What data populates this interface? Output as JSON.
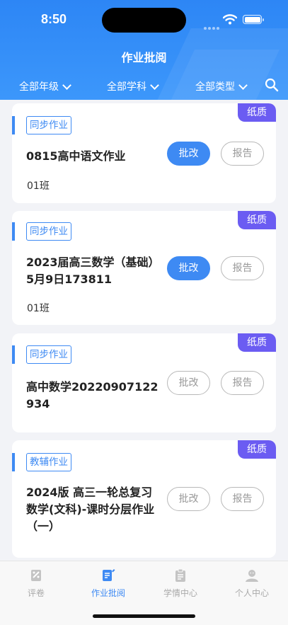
{
  "status_bar": {
    "time": "8:50"
  },
  "header": {
    "title": "作业批阅",
    "filters": [
      {
        "label": "全部年级"
      },
      {
        "label": "全部学科"
      },
      {
        "label": "全部类型"
      }
    ],
    "search_icon": "search-icon"
  },
  "cards": [
    {
      "tag": "同步作业",
      "badge": "纸质",
      "title": "0815高中语文作业",
      "class": "01班",
      "review_label": "批改",
      "report_label": "报告",
      "review_active": true
    },
    {
      "tag": "同步作业",
      "badge": "纸质",
      "title": "2023届高三数学（基础）5月9日173811",
      "class": "01班",
      "review_label": "批改",
      "report_label": "报告",
      "review_active": true
    },
    {
      "tag": "同步作业",
      "badge": "纸质",
      "title": "高中数学20220907122934",
      "class": "",
      "review_label": "批改",
      "report_label": "报告",
      "review_active": false
    },
    {
      "tag": "教辅作业",
      "badge": "纸质",
      "title": "2024版 高三一轮总复习 数学(文科)-课时分层作业（一）",
      "class": "",
      "review_label": "批改",
      "report_label": "报告",
      "review_active": false
    }
  ],
  "tabbar": [
    {
      "label": "评卷",
      "icon": "grading-icon",
      "active": false
    },
    {
      "label": "作业批阅",
      "icon": "homework-review-icon",
      "active": true
    },
    {
      "label": "学情中心",
      "icon": "clipboard-icon",
      "active": false
    },
    {
      "label": "个人中心",
      "icon": "user-icon",
      "active": false
    }
  ],
  "colors": {
    "primary": "#3e8af3",
    "badge": "#6b5cf2",
    "header": "#2d86f5"
  }
}
